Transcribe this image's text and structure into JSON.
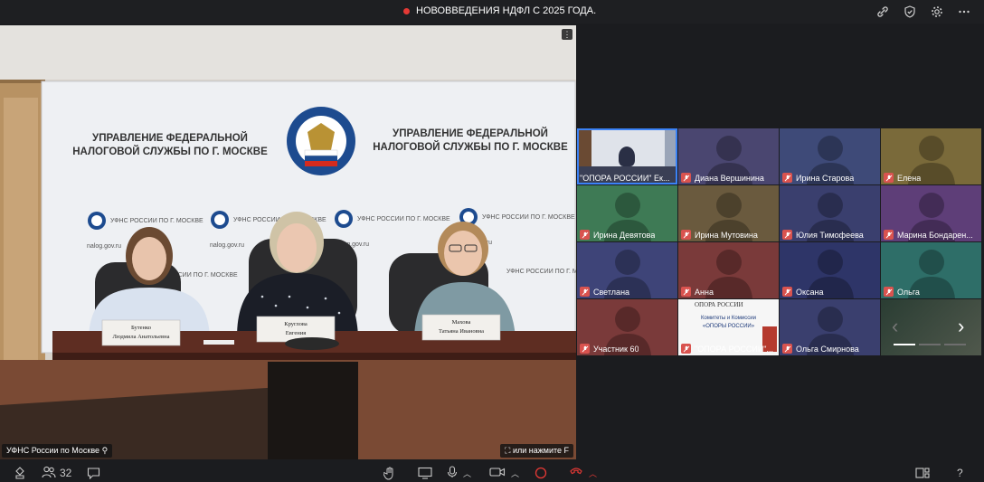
{
  "header": {
    "title": "НОВОВВЕДЕНИЯ НДФЛ С 2025 ГОДА.",
    "rec_color": "#e53935"
  },
  "main_video": {
    "name_label": "УФНС России по Москве",
    "hint": "или нажмите F",
    "banner_left": "УПРАВЛЕНИЕ ФЕДЕРАЛЬНОЙ НАЛОГОВОЙ СЛУЖБЫ ПО Г. МОСКВЕ",
    "banner_right": "УПРАВЛЕНИЕ ФЕДЕРАЛЬНОЙ НАЛОГОВОЙ СЛУЖБЫ ПО Г. МОСКВЕ",
    "seal_text": "ФЕДЕРАЛЬНАЯ НАЛОГОВАЯ СЛУЖБА",
    "small_logo_text": "УФНС РОССИИ ПО Г. МОСКВЕ",
    "site": "nalog.gov.ru",
    "nameplate_1": "Бутенко Людмила Анатольевна",
    "nameplate_2": "Круглова Евгения",
    "nameplate_3": "Махова Татьяна Ивановна"
  },
  "participants": [
    {
      "name": "\"ОПОРА РОССИИ\" Ек...",
      "color": "#5a6a8a",
      "active": true,
      "mic_off": false
    },
    {
      "name": "Диана Вершинина",
      "color": "#4a4670",
      "mic_off": true
    },
    {
      "name": "Ирина Старова",
      "color": "#3e4a78",
      "mic_off": true
    },
    {
      "name": "Елена",
      "color": "#7a6a3a",
      "mic_off": true
    },
    {
      "name": "Ирина Девятова",
      "color": "#3e7a55",
      "mic_off": true
    },
    {
      "name": "Ирина Мутовина",
      "color": "#6a5a3e",
      "mic_off": true
    },
    {
      "name": "Юлия Тимофеева",
      "color": "#3a3f6e",
      "mic_off": true
    },
    {
      "name": "Марина Бондарен...",
      "color": "#5e3e78",
      "mic_off": true
    },
    {
      "name": "Светлана",
      "color": "#3e4478",
      "mic_off": true
    },
    {
      "name": "Анна",
      "color": "#7a3a3a",
      "mic_off": true
    },
    {
      "name": "Оксана",
      "color": "#2e3568",
      "mic_off": true
    },
    {
      "name": "Ольга",
      "color": "#2e6e68",
      "mic_off": true
    },
    {
      "name": "Участник 60",
      "color": "#7a3a3a",
      "mic_off": true
    },
    {
      "name": "\"ОПОРА РОССИИ\"...",
      "color": "#f2f2f2",
      "mic_off": true,
      "slide_title": "ОПОРА РОССИИ",
      "slide_line1": "Комитеты и Комиссии",
      "slide_line2": "«ОПОРЫ РОССИИ»"
    },
    {
      "name": "Ольга Смирнова",
      "color": "#3a3f6e",
      "mic_off": true
    },
    {
      "name": "",
      "color": "#2f4a3e",
      "mic_off": false
    }
  ],
  "toolbar": {
    "participants_count": "32",
    "help": "?"
  },
  "icons": [
    "link-icon",
    "shield-check-icon",
    "gear-icon",
    "more-icon",
    "people-icon",
    "chat-icon",
    "hand-icon",
    "screen-share-icon",
    "mic-icon",
    "camera-icon",
    "record-icon",
    "hangup-icon",
    "layout-icon"
  ],
  "colors": {
    "accent": "#3b82f6",
    "hangup": "#e53935",
    "mic_off": "#d9534f"
  }
}
